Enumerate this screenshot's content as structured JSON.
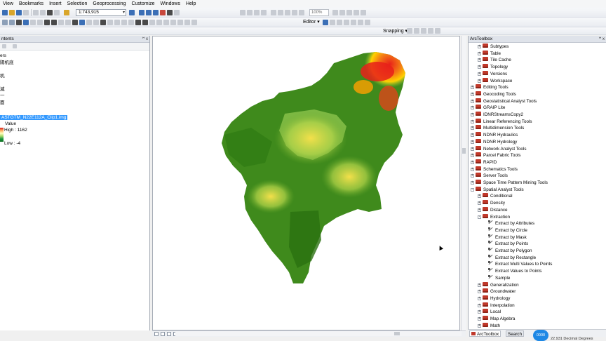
{
  "menu": [
    "View",
    "Bookmarks",
    "Insert",
    "Selection",
    "Geoprocessing",
    "Customize",
    "Windows",
    "Help"
  ],
  "toolbar": {
    "scale_value": "1:743,915",
    "zoom_value": "100%",
    "editor_label": "Editor ▾",
    "snapping_label": "Snapping ▾"
  },
  "toc": {
    "title": "ntents",
    "pin": "ꟸ x",
    "rows": [
      "ers",
      "陽机底",
      "",
      "机",
      "",
      "滅",
      "一",
      "面"
    ],
    "layer_name": "ASTGTM_N22E112A_Clip1.img",
    "legend_title": "Value",
    "high_label": "High : 1162",
    "low_label": "Low : -4"
  },
  "toolbox": {
    "title": "ArcToolbox",
    "ctl": "ꟸ x",
    "items": [
      {
        "label": "Subtypes",
        "level": 2,
        "kind": "toolbox",
        "exp": "+"
      },
      {
        "label": "Table",
        "level": 2,
        "kind": "toolbox",
        "exp": "+"
      },
      {
        "label": "Tile Cache",
        "level": 2,
        "kind": "toolbox",
        "exp": "+"
      },
      {
        "label": "Topology",
        "level": 2,
        "kind": "toolbox",
        "exp": "+"
      },
      {
        "label": "Versions",
        "level": 2,
        "kind": "toolbox",
        "exp": "+"
      },
      {
        "label": "Workspace",
        "level": 2,
        "kind": "toolbox",
        "exp": "+"
      },
      {
        "label": "Editing Tools",
        "level": 1,
        "kind": "toolbox",
        "exp": "+"
      },
      {
        "label": "Geocoding Tools",
        "level": 1,
        "kind": "toolbox",
        "exp": "+"
      },
      {
        "label": "Geostatistical Analyst Tools",
        "level": 1,
        "kind": "toolbox",
        "exp": "+"
      },
      {
        "label": "GRAIP Lite",
        "level": 1,
        "kind": "toolbox",
        "exp": "+"
      },
      {
        "label": "IDNRStreamsCopy2",
        "level": 1,
        "kind": "toolbox",
        "exp": "+"
      },
      {
        "label": "Linear Referencing Tools",
        "level": 1,
        "kind": "toolbox",
        "exp": "+"
      },
      {
        "label": "Multidimension Tools",
        "level": 1,
        "kind": "toolbox",
        "exp": "+"
      },
      {
        "label": "NDNR Hydraulics",
        "level": 1,
        "kind": "toolbox",
        "exp": "+"
      },
      {
        "label": "NDNR Hydrology",
        "level": 1,
        "kind": "toolbox",
        "exp": "+"
      },
      {
        "label": "Network Analyst Tools",
        "level": 1,
        "kind": "toolbox",
        "exp": "+"
      },
      {
        "label": "Parcel Fabric Tools",
        "level": 1,
        "kind": "toolbox",
        "exp": "+"
      },
      {
        "label": "RAPID",
        "level": 1,
        "kind": "toolbox",
        "exp": "+"
      },
      {
        "label": "Schematics Tools",
        "level": 1,
        "kind": "toolbox",
        "exp": "+"
      },
      {
        "label": "Server Tools",
        "level": 1,
        "kind": "toolbox",
        "exp": "+"
      },
      {
        "label": "Space Time Pattern Mining Tools",
        "level": 1,
        "kind": "toolbox",
        "exp": "+"
      },
      {
        "label": "Spatial Analyst Tools",
        "level": 1,
        "kind": "toolbox",
        "exp": "−"
      },
      {
        "label": "Conditional",
        "level": 2,
        "kind": "toolbox",
        "exp": "+"
      },
      {
        "label": "Density",
        "level": 2,
        "kind": "toolbox",
        "exp": "+"
      },
      {
        "label": "Distance",
        "level": 2,
        "kind": "toolbox",
        "exp": "+"
      },
      {
        "label": "Extraction",
        "level": 2,
        "kind": "toolbox",
        "exp": "−"
      },
      {
        "label": "Extract by Attributes",
        "level": 3,
        "kind": "tool",
        "exp": ""
      },
      {
        "label": "Extract by Circle",
        "level": 3,
        "kind": "tool",
        "exp": ""
      },
      {
        "label": "Extract by Mask",
        "level": 3,
        "kind": "tool",
        "exp": ""
      },
      {
        "label": "Extract by Points",
        "level": 3,
        "kind": "tool",
        "exp": ""
      },
      {
        "label": "Extract by Polygon",
        "level": 3,
        "kind": "tool",
        "exp": ""
      },
      {
        "label": "Extract by Rectangle",
        "level": 3,
        "kind": "tool",
        "exp": ""
      },
      {
        "label": "Extract Multi Values to Points",
        "level": 3,
        "kind": "tool",
        "exp": ""
      },
      {
        "label": "Extract Values to Points",
        "level": 3,
        "kind": "tool",
        "exp": ""
      },
      {
        "label": "Sample",
        "level": 3,
        "kind": "tool",
        "exp": ""
      },
      {
        "label": "Generalization",
        "level": 2,
        "kind": "toolbox",
        "exp": "+"
      },
      {
        "label": "Groundwater",
        "level": 2,
        "kind": "toolbox",
        "exp": "+"
      },
      {
        "label": "Hydrology",
        "level": 2,
        "kind": "toolbox",
        "exp": "+"
      },
      {
        "label": "Interpolation",
        "level": 2,
        "kind": "toolbox",
        "exp": "+"
      },
      {
        "label": "Local",
        "level": 2,
        "kind": "toolbox",
        "exp": "+"
      },
      {
        "label": "Map Algebra",
        "level": 2,
        "kind": "toolbox",
        "exp": "+"
      },
      {
        "label": "Math",
        "level": 2,
        "kind": "toolbox",
        "exp": "+"
      }
    ],
    "tabs": [
      "ArcToolbox",
      "Search"
    ]
  },
  "status": {
    "coordinates": "22.931 Decimal Degrees",
    "badge": "0000"
  },
  "colors": {
    "dem_low": "#2f7a12",
    "dem_mid": "#a6d14a",
    "dem_high": "#ffd100",
    "dem_peak": "#e8201a"
  }
}
